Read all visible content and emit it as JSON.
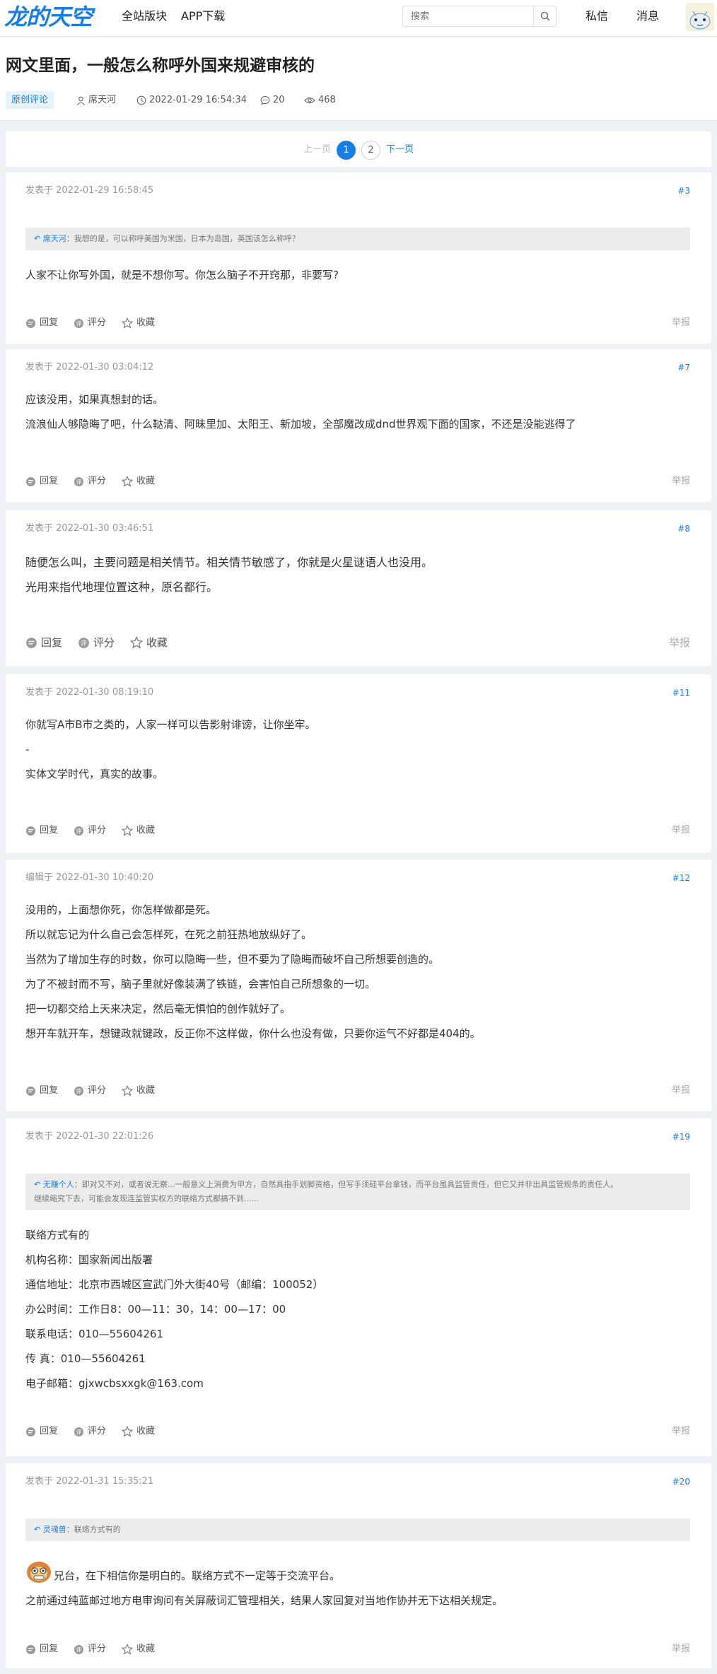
{
  "header": {
    "logo_text": "龙的天空",
    "nav_all_boards": "全站版块",
    "nav_app_download": "APP下载",
    "search_placeholder": "搜索",
    "private_msg": "私信",
    "messages": "消息"
  },
  "thread": {
    "title": "网文里面，一般怎么称呼外国来规避审核的",
    "tag": "原创评论",
    "author": "席天河",
    "datetime": "2022-01-29 16:54:34",
    "comment_count": "20",
    "view_count": "468"
  },
  "pager": {
    "prev": "上一页",
    "pages": [
      "1",
      "2"
    ],
    "next": "下一页"
  },
  "actions": {
    "reply": "回复",
    "rate": "评分",
    "favorite": "收藏",
    "report": "举报"
  },
  "posts": [
    {
      "date": "发表于 2022-01-29 16:58:45",
      "floor": "#3",
      "quote_user": "席天河",
      "quote_text": "：我想的是，可以称呼美国为米国，日本为岛国，英国该怎么称呼？",
      "lines": [
        "人家不让你写外国，就是不想你写。你怎么脑子不开窍那，非要写?"
      ]
    },
    {
      "date": "发表于 2022-01-30 03:04:12",
      "floor": "#7",
      "lines": [
        "应该没用，如果真想封的话。",
        "流浪仙人够隐晦了吧，什么鞑清、阿昧里加、太阳王、新加坡，全部魔改成dnd世界观下面的国家，不还是没能逃得了"
      ]
    },
    {
      "date": "发表于 2022-01-30 03:46:51",
      "floor": "#8",
      "lines": [
        "随便怎么叫，主要问题是相关情节。相关情节敏感了，你就是火星谜语人也没用。",
        "光用来指代地理位置这种，原名都行。"
      ]
    },
    {
      "date": "发表于 2022-01-30 08:19:10",
      "floor": "#11",
      "lines": [
        "你就写A市B市之类的，人家一样可以告影射诽谤，让你坐牢。",
        "-",
        "实体文学时代，真实的故事。"
      ]
    },
    {
      "date": "编辑于 2022-01-30 10:40:20",
      "floor": "#12",
      "lines": [
        "没用的，上面想你死，你怎样做都是死。",
        "所以就忘记为什么自己会怎样死，在死之前狂热地放纵好了。",
        "当然为了增加生存的时数，你可以隐晦一些，但不要为了隐晦而破坏自己所想要创造的。",
        "为了不被封而不写，脑子里就好像装满了铁链，会害怕自己所想象的一切。",
        "把一切都交给上天来决定，然后毫无惧怕的创作就好了。",
        "想开车就开车，想键政就键政，反正你不这样做，你什么也没有做，只要你运气不好都是404的。"
      ]
    },
    {
      "date": "发表于 2022-01-30 22:01:26",
      "floor": "#19",
      "quote_user": "无赚个人",
      "quote_text": "：即对又不对，或者说无察...一般意义上消费为甲方，自然具指手划脚资格，但写手须硅平台拿钱，而平台虽具监管责任，但它又并非出具监管规条的责任人。",
      "quote_text2": "继续缩究下去，可能会发现连监管实权方的联络方式都搞不到......",
      "lines": [
        "联络方式有的",
        "机构名称：国家新闻出版署",
        "通信地址：北京市西城区宣武门外大街40号（邮编：100052）",
        "办公时间：工作日8：00—11：30，14：00—17：00",
        "联系电话：010—55604261",
        "传 真：010—55604261",
        "电子邮箱：gjxwcbsxxgk@163.com"
      ]
    },
    {
      "date": "发表于 2022-01-31 15:35:21",
      "floor": "#20",
      "quote_user": "灵魂兽",
      "quote_text": "：联络方式有的",
      "lines": [
        "兄台，在下相信你是明白的。联络方式不一定等于交流平台。",
        "之前通过纯蓝邮过地方电审询问有关屏蔽词汇管理相关，结果人家回复对当地作协并无下达相关规定。"
      ]
    }
  ]
}
